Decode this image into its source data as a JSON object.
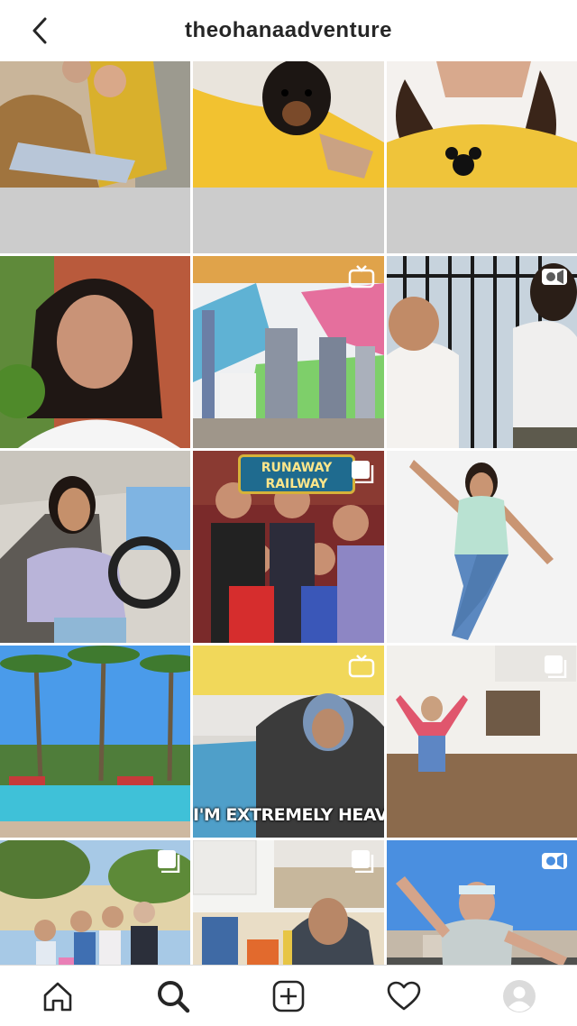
{
  "header": {
    "title": "theohanaadventure",
    "back_icon": "chevron-left-icon"
  },
  "grid": {
    "tiles": [
      {
        "subject": "two girls hugging",
        "badge": "none"
      },
      {
        "subject": "puppy on yellow shirt",
        "badge": "none"
      },
      {
        "subject": "girl in yellow mickey shirt",
        "badge": "none"
      },
      {
        "subject": "girl portrait",
        "badge": "none"
      },
      {
        "subject": "family by mural",
        "badge": "igtv-icon"
      },
      {
        "subject": "kids in ohana shirts",
        "badge": "video-camera-icon"
      },
      {
        "subject": "girl in car",
        "badge": "none"
      },
      {
        "subject": "kids at arcade",
        "badge": "carousel-icon",
        "sign_text": "RUNAWAY RAILWAY"
      },
      {
        "subject": "girl jumping",
        "badge": "none"
      },
      {
        "subject": "pool with palm trees",
        "badge": "none"
      },
      {
        "subject": "boy in ohana hoodie",
        "badge": "igtv-icon",
        "caption": "I'M EXTREMELY HEAVY"
      },
      {
        "subject": "girl jumping in kitchen",
        "badge": "carousel-icon"
      },
      {
        "subject": "family portrait",
        "badge": "carousel-icon"
      },
      {
        "subject": "boy with snacks",
        "badge": "carousel-icon"
      },
      {
        "subject": "man in cap",
        "badge": "video-camera-icon"
      }
    ]
  },
  "nav": {
    "items": [
      {
        "name": "home",
        "icon": "home-icon"
      },
      {
        "name": "search",
        "icon": "search-icon",
        "active": true
      },
      {
        "name": "new-post",
        "icon": "add-post-icon"
      },
      {
        "name": "activity",
        "icon": "heart-icon"
      },
      {
        "name": "profile",
        "icon": "avatar-icon"
      }
    ]
  },
  "colors": {
    "text": "#262626",
    "border": "#dbdbdb",
    "icon": "#262626"
  }
}
